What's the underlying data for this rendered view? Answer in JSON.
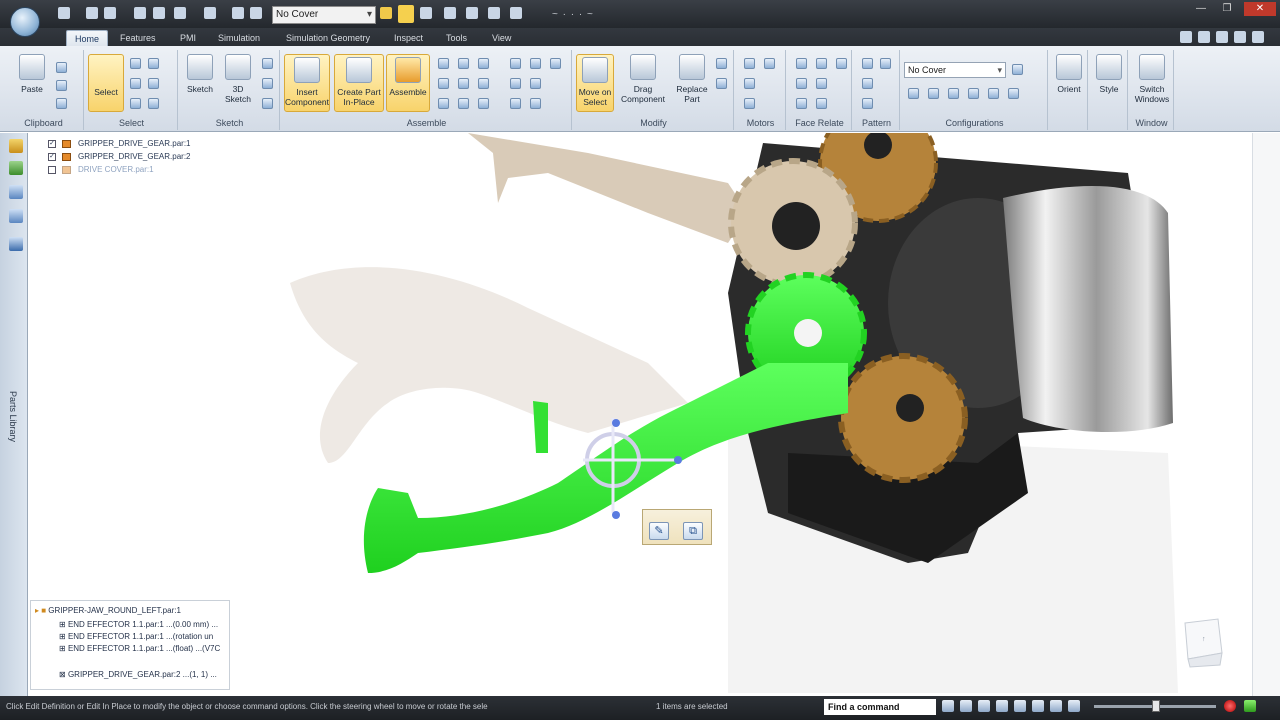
{
  "quick_access": {
    "config_combo": "No Cover",
    "title_text": "~ · · · ~"
  },
  "tabs": [
    {
      "label": "Home",
      "active": true
    },
    {
      "label": "Features"
    },
    {
      "label": "PMI"
    },
    {
      "label": "Simulation"
    },
    {
      "label": "Simulation Geometry"
    },
    {
      "label": "Inspect"
    },
    {
      "label": "Tools"
    },
    {
      "label": "View"
    }
  ],
  "ribbon": {
    "clipboard": {
      "paste": "Paste",
      "label": "Clipboard"
    },
    "select": {
      "select": "Select",
      "label": "Select"
    },
    "sketch": {
      "sketch": "Sketch",
      "sketch3d_l1": "3D",
      "sketch3d_l2": "Sketch",
      "label": "Sketch"
    },
    "assemble": {
      "insert_l1": "Insert",
      "insert_l2": "Component",
      "create_l1": "Create Part",
      "create_l2": "In-Place",
      "assemble": "Assemble",
      "label": "Assemble"
    },
    "modify": {
      "move_l1": "Move on",
      "move_l2": "Select",
      "drag_l1": "Drag",
      "drag_l2": "Component",
      "replace_l1": "Replace",
      "replace_l2": "Part",
      "label": "Modify"
    },
    "motors": {
      "label": "Motors"
    },
    "face_relate": {
      "label": "Face Relate"
    },
    "pattern": {
      "label": "Pattern"
    },
    "configurations": {
      "combo": "No Cover",
      "label": "Configurations"
    },
    "orient": {
      "label": "Orient"
    },
    "style": {
      "label": "Style"
    },
    "window": {
      "switch_l1": "Switch",
      "switch_l2": "Windows",
      "label": "Window"
    }
  },
  "left_bar": {
    "parts_library": "Parts Library"
  },
  "tree_top": [
    {
      "label": "GRIPPER_DRIVE_GEAR.par:1",
      "checked": true
    },
    {
      "label": "GRIPPER_DRIVE_GEAR.par:2",
      "checked": true
    },
    {
      "label": "DRIVE COVER.par:1",
      "checked": false
    }
  ],
  "tree_panel": {
    "header": "GRIPPER-JAW_ROUND_LEFT.par:1",
    "rows": [
      "END EFFECTOR 1.1.par:1 ...(0.00 mm) ...",
      "END EFFECTOR 1.1.par:1 ...(rotation un",
      "END EFFECTOR 1.1.par:1 ...(float) ...(V7C"
    ],
    "last_row": "GRIPPER_DRIVE_GEAR.par:2 ...(1, 1) ..."
  },
  "status": {
    "message": "Click Edit Definition or Edit In Place to modify the object or choose command options. Click the steering wheel to move or rotate the sele",
    "selection": "1 items are selected",
    "find_command": "Find a command"
  },
  "colors": {
    "selected_part": "#2aef2a",
    "gear": "#b5833a",
    "housing": "#2b2b2b",
    "arm": "#d9cbb8",
    "accent": "#f8d36b"
  }
}
